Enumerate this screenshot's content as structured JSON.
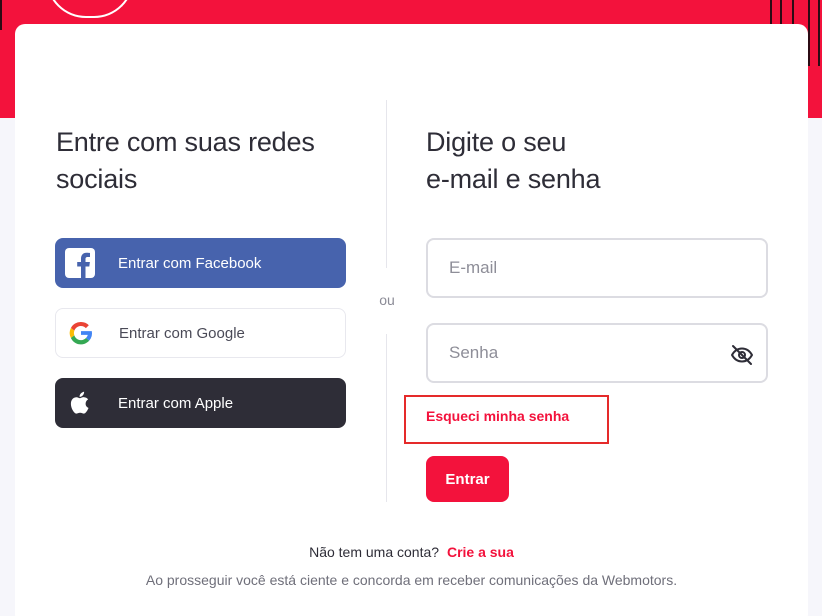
{
  "colors": {
    "brand": "#f3123c",
    "facebook": "#4763ad",
    "apple": "#2e2d37",
    "highlight_box": "#e52a2a"
  },
  "social": {
    "heading_line1": "Entre com suas redes",
    "heading_line2": "sociais",
    "facebook_label": "Entrar com Facebook",
    "google_label": "Entrar com Google",
    "apple_label": "Entrar com Apple",
    "facebook_icon": "facebook-icon",
    "google_icon": "google-icon",
    "apple_icon": "apple-icon"
  },
  "divider": {
    "or_label": "ou"
  },
  "login": {
    "heading_line1": "Digite o seu",
    "heading_line2": "e-mail e senha",
    "email_placeholder": "E-mail",
    "email_value": "",
    "password_placeholder": "Senha",
    "password_value": "",
    "password_toggle_icon": "eye-off-icon",
    "forgot_label": "Esqueci minha senha",
    "submit_label": "Entrar"
  },
  "footer": {
    "signup_text": "Não tem uma conta?",
    "signup_link": "Crie a sua",
    "terms_text": "Ao prosseguir você está ciente e concorda em receber comunicações da Webmotors."
  }
}
